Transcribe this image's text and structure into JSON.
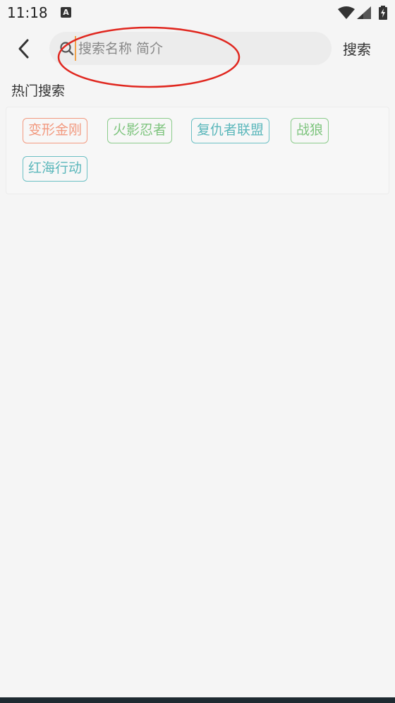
{
  "status_bar": {
    "time": "11:18",
    "notification_letter": "A"
  },
  "search": {
    "placeholder": "搜索名称 简介",
    "value": "",
    "button_label": "搜索"
  },
  "hot_search": {
    "title": "热门搜索",
    "tags": [
      {
        "label": "变形金刚",
        "color": "#f29a80"
      },
      {
        "label": "火影忍者",
        "color": "#7ec47e"
      },
      {
        "label": "复仇者联盟",
        "color": "#5bb7bb"
      },
      {
        "label": "战狼",
        "color": "#7ec47e"
      },
      {
        "label": "红海行动",
        "color": "#5bb7bb"
      }
    ]
  },
  "colors": {
    "background": "#f5f5f5",
    "annotation_ring": "#e0271f",
    "cursor": "#f0a24a"
  }
}
